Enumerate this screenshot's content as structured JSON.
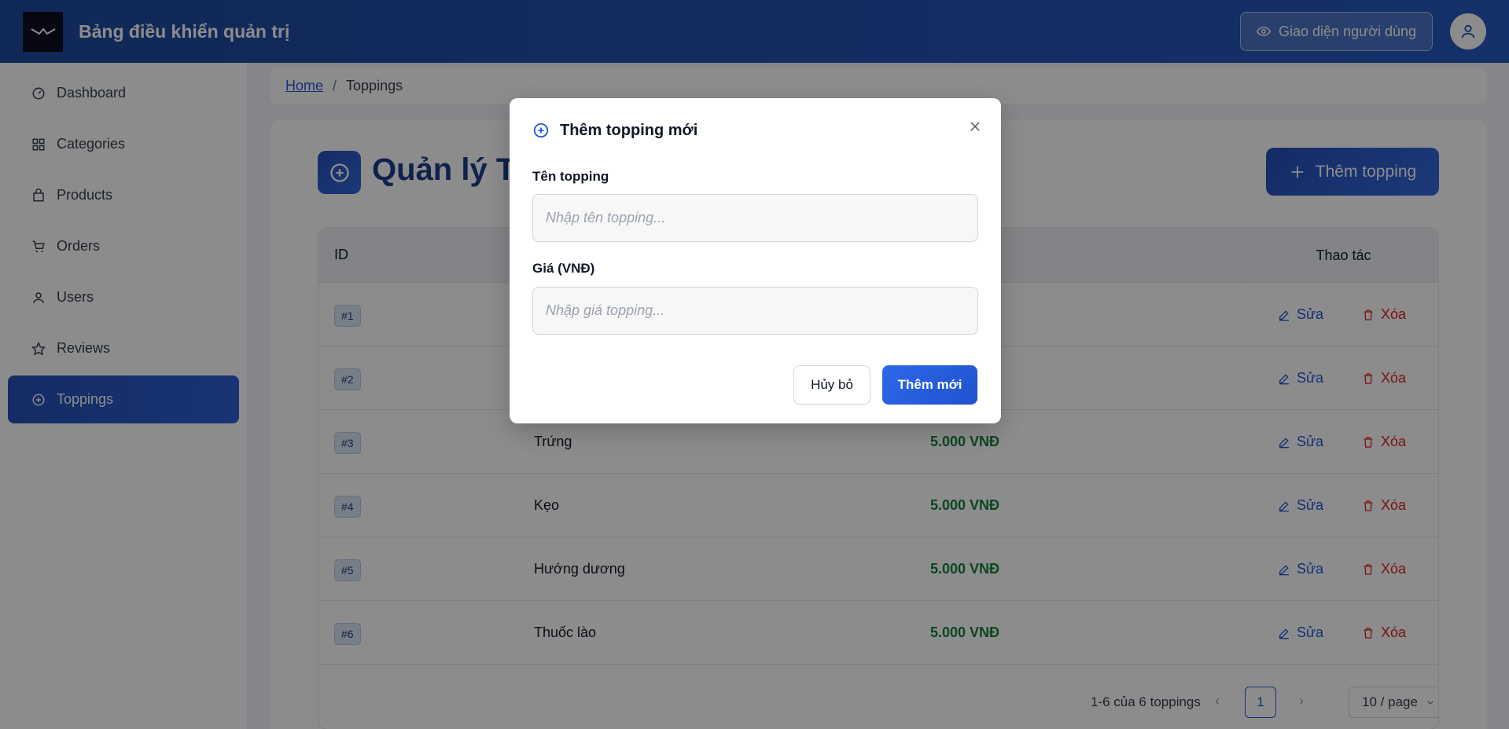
{
  "header": {
    "app_title": "Bảng điều khiển quản trị",
    "user_view_label": "Giao diện người dùng"
  },
  "sidebar": {
    "items": [
      {
        "label": "Dashboard",
        "icon": "dashboard-icon"
      },
      {
        "label": "Categories",
        "icon": "grid-icon"
      },
      {
        "label": "Products",
        "icon": "bag-icon"
      },
      {
        "label": "Orders",
        "icon": "cart-icon"
      },
      {
        "label": "Users",
        "icon": "user-icon"
      },
      {
        "label": "Reviews",
        "icon": "star-icon"
      },
      {
        "label": "Toppings",
        "icon": "plus-circle-icon",
        "active": true
      }
    ]
  },
  "breadcrumb": {
    "home": "Home",
    "separator": "/",
    "current": "Toppings"
  },
  "page": {
    "title": "Quản lý Toppings",
    "add_button": "Thêm topping"
  },
  "table": {
    "col_id": "ID",
    "col_actions": "Thao tác",
    "edit_label": "Sửa",
    "delete_label": "Xóa",
    "rows": [
      {
        "id": "#1",
        "name": "",
        "price": ""
      },
      {
        "id": "#2",
        "name": "",
        "price": ""
      },
      {
        "id": "#3",
        "name": "Trứng",
        "price": "5.000 VNĐ"
      },
      {
        "id": "#4",
        "name": "Kẹo",
        "price": "5.000 VNĐ"
      },
      {
        "id": "#5",
        "name": "Hướng dương",
        "price": "5.000 VNĐ"
      },
      {
        "id": "#6",
        "name": "Thuốc lào",
        "price": "5.000 VNĐ"
      }
    ]
  },
  "pagination": {
    "summary": "1-6 của 6 toppings",
    "current_page": "1",
    "page_size": "10 / page"
  },
  "modal": {
    "title": "Thêm topping mới",
    "name_label": "Tên topping",
    "name_placeholder": "Nhập tên topping...",
    "price_label": "Giá (VNĐ)",
    "price_placeholder": "Nhập giá topping...",
    "cancel_label": "Hủy bỏ",
    "submit_label": "Thêm mới"
  },
  "colors": {
    "brand": "#2451b8",
    "price": "#15803d",
    "delete": "#dc2626",
    "edit": "#2458d6"
  }
}
